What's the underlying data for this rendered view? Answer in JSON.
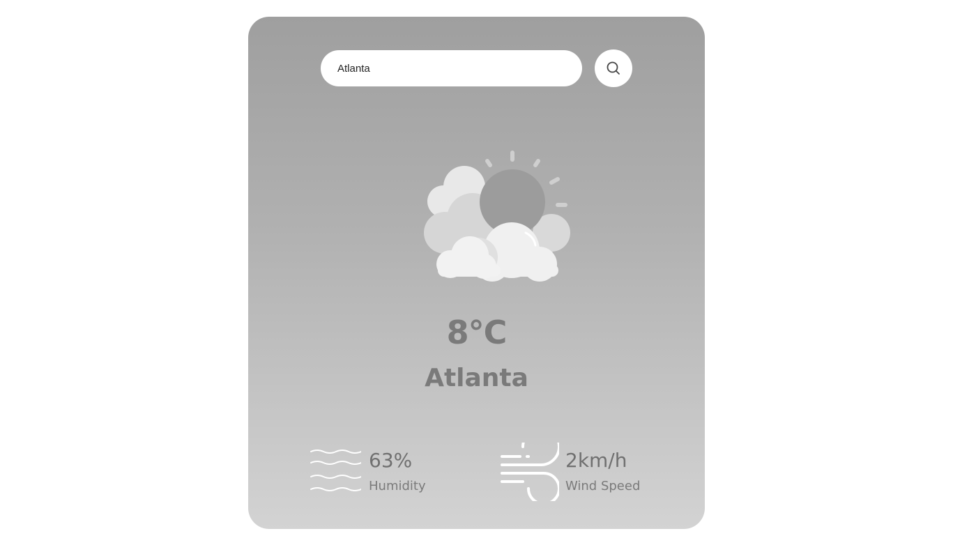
{
  "search": {
    "value": "Atlanta"
  },
  "icons": {
    "search": "search-icon",
    "weather": "partly-cloudy-icon",
    "humidity": "humidity-waves-icon",
    "wind": "wind-icon"
  },
  "weather": {
    "temperature": "8°C",
    "city": "Atlanta"
  },
  "details": {
    "humidity": {
      "value": "63%",
      "label": "Humidity"
    },
    "wind": {
      "value": "2km/h",
      "label": "Wind Speed"
    }
  },
  "colors": {
    "card_top": "#9f9f9f",
    "card_bottom": "#d3d3d3",
    "text": "#7a7a7a"
  }
}
